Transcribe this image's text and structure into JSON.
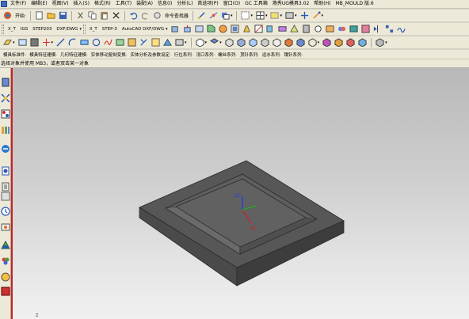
{
  "menubar": {
    "items": [
      "文件(F)",
      "编辑(E)",
      "视图(V)",
      "插入(S)",
      "格式(R)",
      "工具(T)",
      "装配(A)",
      "信息(I)",
      "分析(L)",
      "首选项(P)",
      "窗口(O)",
      "GC 工具箱",
      "燕秀UG模具3.02",
      "帮助(H)",
      "MB_MOULD 版.6"
    ]
  },
  "toolbar1": {
    "start_label": "开始·",
    "command_finder_label": "命令查找器"
  },
  "toolbar2": {
    "items": [
      "X_T",
      "IGS",
      "STEP203",
      "DXF/DWG",
      "X_T",
      "STEP-3",
      "AutoCAD DXF/DWG"
    ]
  },
  "menubar2": {
    "items": [
      "模具标准件·",
      "模具特征建模·",
      "几何特征建模·",
      "实体移动复制变换·",
      "实体分析及参数设定·",
      "行位系列·",
      "浇口系列·",
      "螺丝系列·",
      "顶针系列·",
      "运水系列·",
      "镶针系列·"
    ]
  },
  "status": {
    "message": "选择对象并使用 MB3，或者双击某一对象"
  },
  "viewport": {
    "axis_labels": {
      "z": "ZC",
      "x": "XC"
    },
    "corner_label": "Z"
  },
  "colors": {
    "background": "#d4d0c8",
    "toolbar": "#ece9d8",
    "model_face": "#5a5a5a",
    "axis_x": "#d42020",
    "axis_y": "#20b020",
    "axis_z": "#2040e0"
  }
}
